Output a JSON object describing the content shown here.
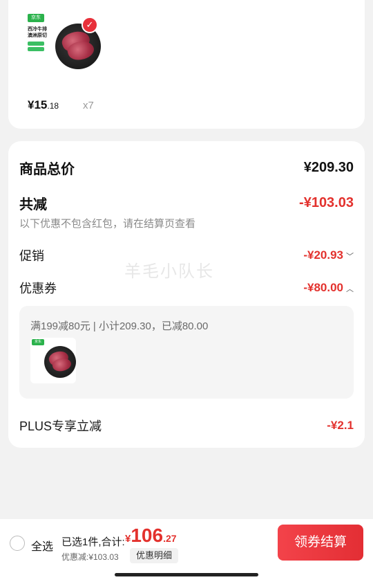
{
  "product": {
    "brand_badge": "京东",
    "tag_line1": "西冷牛排",
    "tag_line2": "澳洲原切",
    "price_int": "¥15",
    "price_dec": ".18",
    "quantity": "x7",
    "colors": {
      "brand_green": "#2bb24c",
      "check_red": "#e8303a"
    }
  },
  "summary": {
    "total_label": "商品总价",
    "total_value": "¥209.30",
    "reduce_label": "共减",
    "reduce_value": "-¥103.03",
    "reduce_note": "以下优惠不包含红包，请在结算页查看",
    "promo_label": "促销",
    "promo_value": "-¥20.93",
    "coupon_label": "优惠券",
    "coupon_value": "-¥80.00",
    "coupon_detail": "满199减80元 | 小计209.30，已减80.00",
    "plus_label": "PLUS专享立减",
    "plus_value": "-¥2.1"
  },
  "watermark": "羊毛小队长",
  "bottom_bar": {
    "select_all": "全选",
    "selected_text": "已选1件,合计:",
    "total_currency": "¥",
    "total_int": "106",
    "total_dec": ".27",
    "discount_text": "优惠减:¥103.03",
    "detail_button": "优惠明细",
    "pay_button": "领券结算",
    "accent": "#e3312d"
  }
}
